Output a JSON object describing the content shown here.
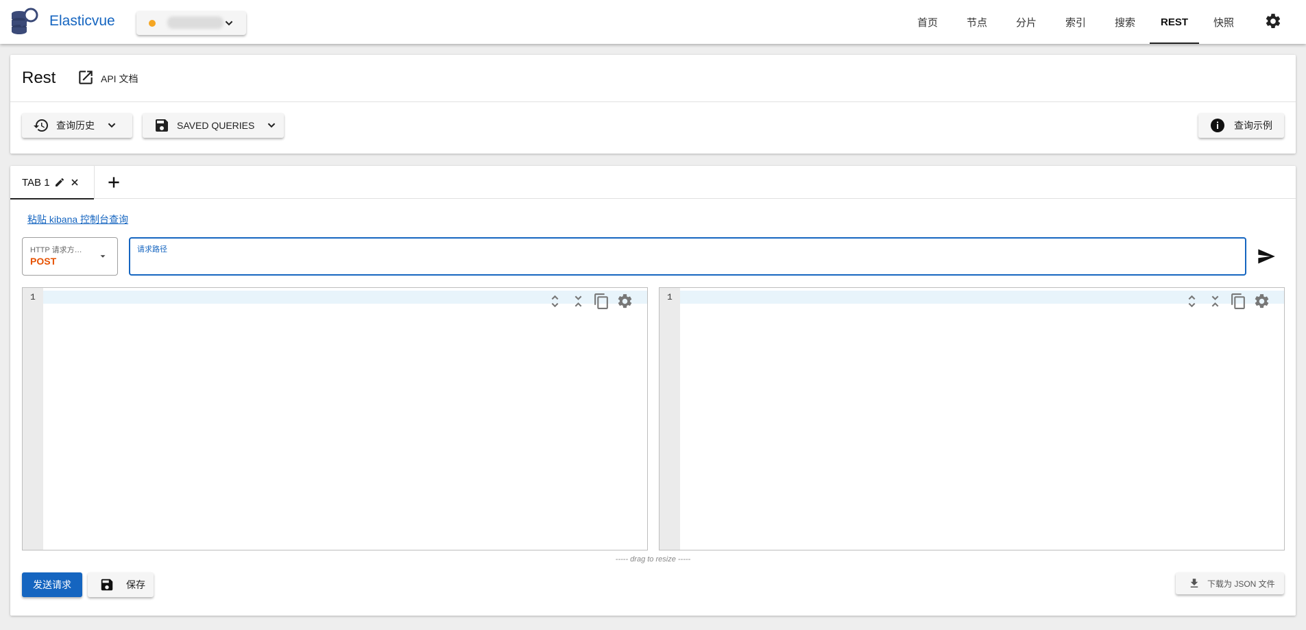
{
  "app": {
    "brand": "Elasticvue",
    "cluster_status_color": "#f5a623"
  },
  "nav": {
    "items": [
      {
        "label": "首页"
      },
      {
        "label": "节点"
      },
      {
        "label": "分片"
      },
      {
        "label": "索引"
      },
      {
        "label": "搜索"
      },
      {
        "label": "REST",
        "active": true
      },
      {
        "label": "快照"
      }
    ]
  },
  "header": {
    "title": "Rest",
    "api_docs_label": "API 文档"
  },
  "toolbar": {
    "history_label": "查询历史",
    "saved_queries_label": "SAVED QUERIES",
    "examples_label": "查询示例"
  },
  "tabs": [
    {
      "label": "TAB 1",
      "active": true
    }
  ],
  "request": {
    "kibana_link": "粘贴 kibana 控制台查询",
    "method_label": "HTTP 请求方…",
    "method_value": "POST",
    "path_label": "请求路径",
    "path_value": ""
  },
  "editors": {
    "left_line_number": "1",
    "right_line_number": "1",
    "resize_hint": "----- drag to resize -----"
  },
  "actions": {
    "send_label": "发送请求",
    "save_label": "保存",
    "download_label": "下载为 JSON 文件"
  },
  "colors": {
    "primary": "#1565c0",
    "method": "#e65100"
  }
}
